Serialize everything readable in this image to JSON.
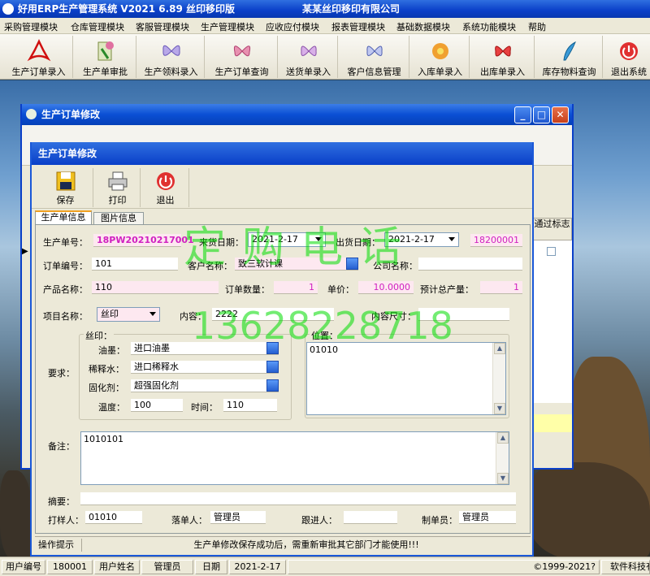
{
  "app": {
    "title": "好用ERP生产管理系统  V2021  6.89 丝印移印版",
    "company": "某某丝印移印有限公司"
  },
  "menu": [
    "采购管理模块",
    "仓库管理模块",
    "客服管理模块",
    "生产管理模块",
    "应收应付模块",
    "报表管理模块",
    "基础数据模块",
    "系统功能模块",
    "帮助"
  ],
  "toolbar": [
    {
      "label": "生产订单录入",
      "icon": "pdf-icon"
    },
    {
      "label": "生产单审批",
      "icon": "approve-icon"
    },
    {
      "label": "生产领料录入",
      "icon": "butterfly-icon"
    },
    {
      "label": "生产订单查询",
      "icon": "query-icon"
    },
    {
      "label": "送货单录入",
      "icon": "delivery-icon"
    },
    {
      "label": "客户信息管理",
      "icon": "customer-icon"
    },
    {
      "label": "入库单录入",
      "icon": "inbound-icon"
    },
    {
      "label": "出库单录入",
      "icon": "outbound-icon"
    },
    {
      "label": "库存物料查询",
      "icon": "inventory-icon"
    },
    {
      "label": "退出系统",
      "icon": "exit-icon"
    }
  ],
  "back_window": {
    "title": "生产订单修改",
    "col_header": "通过标志"
  },
  "form": {
    "title": "生产订单修改",
    "buttons": {
      "save": "保存",
      "print": "打印",
      "exit": "退出"
    },
    "tabs": [
      "生产单信息",
      "图片信息"
    ],
    "prod_no_label": "生产单号：",
    "prod_no": "18PW20210217001",
    "recv_date_label": "来货日期：",
    "recv_date": "2021-2-17",
    "ship_date_label": "出货日期：",
    "ship_date": "2021-2-17",
    "code": "18200001",
    "order_no_label": "订单编号：",
    "order_no": "101",
    "customer_label": "客户名称：",
    "customer": "致三软计课",
    "company_label": "公司名称：",
    "company": "",
    "product_label": "产品名称：",
    "product": "110",
    "qty_label": "订单数量：",
    "qty": "1",
    "price_label": "单价：",
    "price": "10.0000",
    "est_label": "预计总产量：",
    "est": "1",
    "item_label": "项目名称：",
    "item": "丝印",
    "content_label": "内容：",
    "content": "2222",
    "size_label": "内容尺寸：",
    "size": "",
    "require_label": "要求：",
    "silk_label": "丝印：",
    "ink_label": "油墨：",
    "ink": "进口油墨",
    "thinner_label": "稀释水：",
    "thinner": "进口稀释水",
    "hardener_label": "固化剂：",
    "hardener": "超强固化剂",
    "temp_label": "温度：",
    "temp": "100",
    "time_label": "时间：",
    "time": "110",
    "position_label": "位置：",
    "position": "01010",
    "remark_label": "备注：",
    "remark": "1010101",
    "summary_label": "摘要：",
    "summary": "",
    "sampler_label": "打样人：",
    "sampler": "01010",
    "placer_label": "落单人：",
    "placer": "管理员",
    "follower_label": "跟进人：",
    "follower": "",
    "maker_label": "制单员：",
    "maker": "管理员",
    "hint_label": "操作提示",
    "hint": "生产单修改保存成功后，需重新审批其它部门才能使用!!!"
  },
  "watermark": {
    "line1": "定购电话",
    "line2": "13628228718"
  },
  "status": {
    "user_no_label": "用户编号",
    "user_no": "180001",
    "user_name_label": "用户姓名",
    "user_name": "管理员",
    "date_label": "日期",
    "date": "2021-2-17",
    "copyright": "©1999-2021?",
    "vendor": "软件科技有"
  }
}
